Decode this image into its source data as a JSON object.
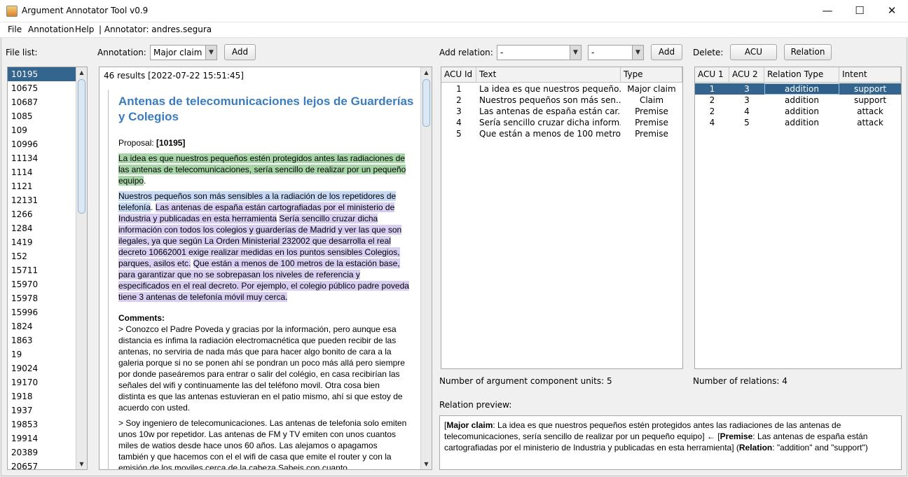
{
  "window": {
    "title": "Argument Annotator Tool v0.9",
    "controls": {
      "minimize": "—",
      "maximize": "☐",
      "close": "✕"
    }
  },
  "menu": {
    "items": [
      "File",
      "Annotation",
      "Help"
    ],
    "annotator": "| Annotator: andres.segura"
  },
  "file_list": {
    "label": "File list:",
    "selected": "10195",
    "items": [
      "10195",
      "10675",
      "10687",
      "1085",
      "109",
      "10996",
      "11134",
      "1114",
      "1121",
      "12131",
      "1266",
      "1284",
      "1419",
      "152",
      "15711",
      "15970",
      "15978",
      "15996",
      "1824",
      "1863",
      "19",
      "19024",
      "19170",
      "1918",
      "1937",
      "19853",
      "19914",
      "20389",
      "20657"
    ]
  },
  "annotation": {
    "label": "Annotation:",
    "type_selected": "Major claim",
    "add_button": "Add"
  },
  "document": {
    "results": "46 results [2022-07-22 15:51:45]",
    "title": "Antenas de telecomunicaciones lejos de Guarderías y Colegios",
    "proposal_label": "Proposal:",
    "proposal_id": "[10195]",
    "seg_green": "La idea es que nuestros pequeños estén protegidos antes las radiaciones de las antenas de telecomunicaciones, sería sencillo de realizar por un pequeño equipo",
    "seg_green_tail": ".",
    "seg_blue": "Nuestros pequeños son más sensibles a la radiación de los repetidores de telefonía",
    "seg_blue_tail": ".",
    "seg_purple_1": "Las antenas de españa están cartografiadas por el ministerio de Industria y publicadas en esta herramienta",
    "seg_purple_2": "Sería sencillo cruzar dicha información con todos los colegios y guarderías de Madrid y ver las que son ilegales, ya que según La Orden Ministerial 232002 que desarrolla el real decreto 10662001 exige realizar medidas en los puntos sensibles Colegios, parques, asilos etc.",
    "seg_purple_3": "Que están a menos de 100 metros de la estación base, para garantizar que no se sobrepasan los niveles de referencia y especificados en el real decreto. Por ejemplo, el colegio público padre poveda tiene 3 antenas de telefonía móvil muy cerca.",
    "comments_label": "Comments:",
    "comment_1": "> Conozco el Padre Poveda y gracias por la información, pero aunque esa distancia es ínfima la radiación electromacnética que pueden recibir de las antenas, no serviria de nada más que para hacer algo bonito de cara a la galeria porque si no se ponen ahí se pondran un poco más allá pero siempre por donde paseáremos para entrar o salir del colégio, en casa recibirían las señales del wifi y continuamente las del teléfono movil. Otra cosa bien distinta es que las antenas estuvieran en el patio mismo, ahí si que estoy de acuerdo con usted.",
    "comment_2": "> Soy ingeniero de telecomunicaciones. Las antenas de telefonia solo emiten unos 10w por repetidor. Las antenas de FM y TV emiten con unos cuantos miles de watios desde hace unos 60 años. Las alejamos o apagamos también y que hacemos con el el wifi de casa que emite el router y con la emisión de los moviles cerca de la cabeza Sabeis con cuanto"
  },
  "add_relation": {
    "label": "Add relation:",
    "combo1": "-",
    "combo2": "-",
    "add_button": "Add"
  },
  "delete": {
    "label": "Delete:",
    "acu_button": "ACU",
    "relation_button": "Relation"
  },
  "acu_table": {
    "headers": [
      "ACU Id",
      "Text",
      "Type"
    ],
    "rows": [
      [
        "1",
        "La idea es que nuestros pequeño...",
        "Major claim"
      ],
      [
        "2",
        "Nuestros pequeños son más sen...",
        "Claim"
      ],
      [
        "3",
        "Las antenas de españa están car...",
        "Premise"
      ],
      [
        "4",
        "Sería sencillo cruzar dicha inform...",
        "Premise"
      ],
      [
        "5",
        "Que están a menos de 100 metro...",
        "Premise"
      ]
    ],
    "count_text": "Number of argument component units: 5"
  },
  "relation_table": {
    "headers": [
      "ACU 1",
      "ACU 2",
      "Relation Type",
      "Intent"
    ],
    "rows": [
      [
        "1",
        "3",
        "addition",
        "support"
      ],
      [
        "2",
        "3",
        "addition",
        "support"
      ],
      [
        "2",
        "4",
        "addition",
        "attack"
      ],
      [
        "4",
        "5",
        "addition",
        "attack"
      ]
    ],
    "selected_row": 0,
    "count_text": "Number of relations: 4"
  },
  "relation_preview": {
    "label": "Relation preview:",
    "lb1": "[",
    "type1": "Major claim",
    "text1": ": La idea es que nuestros pequeños estén protegidos antes las radiaciones de las antenas de telecomunicaciones, sería sencillo de realizar por un pequeño equipo] ← [",
    "type2": "Premise",
    "text2": ": Las antenas de españa están cartografiadas por el ministerio de Industria y publicadas en esta herramienta] (",
    "rel_label": "Relation",
    "rel_text": ": \"addition\" and \"support\")"
  }
}
